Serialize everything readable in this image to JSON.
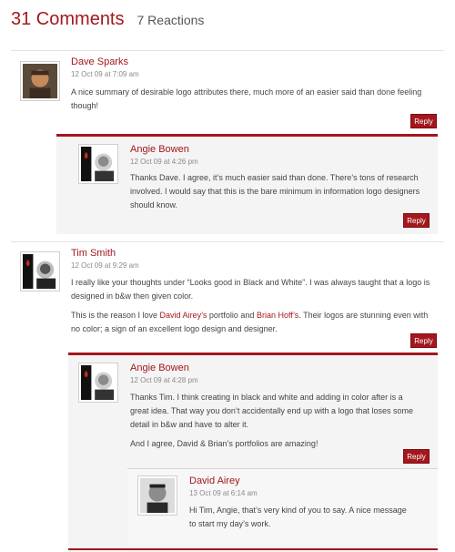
{
  "header": {
    "comment_count": "31 Comments",
    "reactions": "7 Reactions"
  },
  "comments": [
    {
      "author": "Dave Sparks",
      "date": "12 Oct 09 at 7:09 am",
      "body": [
        "A nice summary of desirable logo attributes there, much more of an easier said than done feeling though!"
      ],
      "reply_label": "Reply",
      "avatar_icon": "person-photo-icon"
    },
    {
      "author": "Angie Bowen",
      "date": "12 Oct 09 at 4:26 pm",
      "body": [
        "Thanks Dave. I agree, it’s much easier said than done. There’s tons of research involved. I would say that this is the bare minimum in information logo designers should know."
      ],
      "reply_label": "Reply",
      "avatar_icon": "fuel-logo-avatar-icon"
    },
    {
      "author": "Tim Smith",
      "date": "12 Oct 09 at 9:29 am",
      "body_1": "I really like your thoughts under “Looks good in Black and White”. I was always taught that a logo is designed in b&w then given color.",
      "body_2_pre": "This is the reason I love ",
      "body_2_link1": "David Airey’s",
      "body_2_mid": " portfolio and ",
      "body_2_link2": "Brian Hoff’s",
      "body_2_post": ". Their logos are stunning even with no color; a sign of an excellent logo design and designer.",
      "reply_label": "Reply",
      "avatar_icon": "fuel-logo-avatar-icon"
    },
    {
      "author": "Angie Bowen",
      "date": "12 Oct 09 at 4:28 pm",
      "body_1": "Thanks Tim. I think creating in black and white and adding in color after is a great idea. That way you don’t accidentally end up with a logo that loses some detail in b&w and have to alter it.",
      "body_2": "And I agree, David & Brian’s portfolios are amazing!",
      "reply_label": "Reply",
      "avatar_icon": "fuel-logo-avatar-icon"
    },
    {
      "author": "David Airey",
      "date": "13 Oct 09 at 6:14 am",
      "body": [
        "Hi Tim, Angie, that’s very kind of you to say. A nice message to start my day’s work."
      ],
      "avatar_icon": "person-photo-icon"
    }
  ],
  "colors": {
    "accent": "#a3171d",
    "reply_bg": "#f4f4f4",
    "text": "#444444"
  }
}
